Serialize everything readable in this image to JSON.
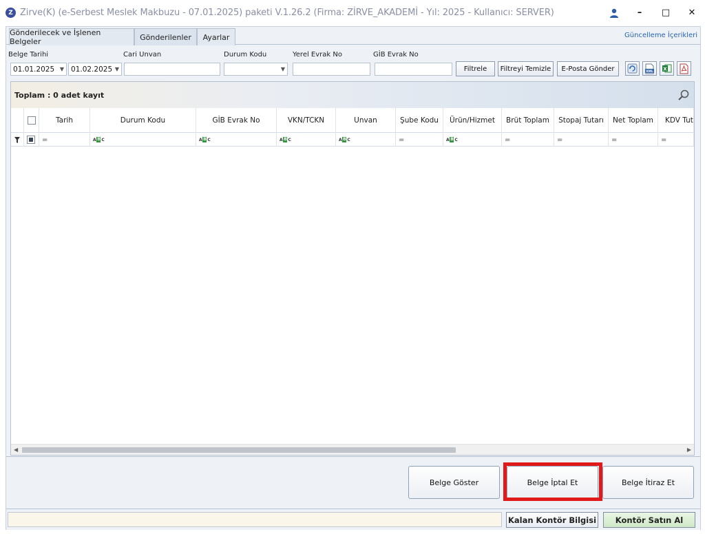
{
  "window": {
    "title": "Zirve(K)  (e-Serbest Meslek Makbuzu - 07.01.2025) paketi V.1.26.2 (Firma: ZİRVE_AKADEMİ - Yıl: 2025 - Kullanıcı: SERVER)",
    "logo_letter": "Z",
    "minimize": "–",
    "maximize": "□",
    "close": "✕"
  },
  "tabs": [
    {
      "label": "Gönderilecek ve İşlenen Belgeler",
      "active": false
    },
    {
      "label": "Gönderilenler",
      "active": true
    },
    {
      "label": "Ayarlar",
      "active": false
    }
  ],
  "update_link": "Güncelleme İçerikleri",
  "filters": {
    "belge_tarihi_label": "Belge Tarihi",
    "date_from": "01.01.2025",
    "date_to": "01.02.2025",
    "cari_unvan_label": "Cari Unvan",
    "cari_unvan_value": "",
    "durum_kodu_label": "Durum Kodu",
    "durum_kodu_value": "",
    "yerel_evrak_label": "Yerel Evrak No",
    "yerel_evrak_value": "",
    "gib_evrak_label": "GİB Evrak No",
    "gib_evrak_value": "",
    "filtrele": "Filtrele",
    "filtreyi_temizle": "Filtreyi Temizle",
    "eposta_gonder": "E-Posta Gönder",
    "icons": [
      "refresh-icon",
      "xml-export-icon",
      "excel-export-icon",
      "pdf-export-icon"
    ]
  },
  "grid": {
    "total_label": "Toplam : 0 adet kayıt",
    "columns": [
      "Tarih",
      "Durum Kodu",
      "GİB Evrak No",
      "VKN/TCKN",
      "Unvan",
      "Şube Kodu",
      "Ürün/Hizmet",
      "Brüt Toplam",
      "Stopaj Tutarı",
      "Net Toplam",
      "KDV Tutarı"
    ],
    "filter_types": [
      "equals",
      "text",
      "text",
      "text",
      "text",
      "equals",
      "text",
      "equals",
      "equals",
      "equals",
      "equals"
    ],
    "filter_text_glyph": "ABC",
    "filter_equals_glyph": "=",
    "rows": []
  },
  "actions": {
    "belge_goster": "Belge Göster",
    "belge_iptal_et": "Belge İptal Et",
    "belge_itiraz_et": "Belge İtiraz Et",
    "highlighted": "Belge İptal Et"
  },
  "status": {
    "message": "",
    "kalan_kontor": "Kalan Kontör Bilgisi",
    "kontor_satin_al": "Kontör Satın Al"
  },
  "colors": {
    "highlight": "#e01a1a",
    "logo": "#3a4ea0",
    "link": "#2463b8",
    "buy_button": "#dff0d8"
  }
}
